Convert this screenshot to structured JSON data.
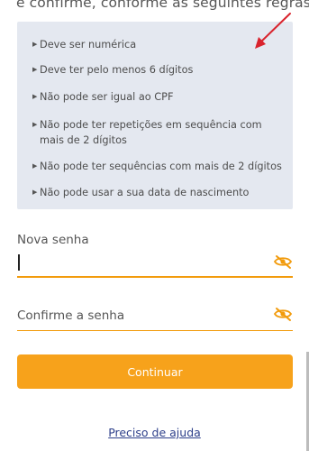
{
  "intro_text": "e confirme, conforme as seguintes regras:",
  "rules": [
    {
      "text": "Deve ser numérica"
    },
    {
      "text": "Deve ter pelo menos 6 dígitos"
    },
    {
      "text": "Não pode ser igual ao CPF"
    },
    {
      "text": "Não pode ter repetições em sequência com mais de 2 dígitos"
    },
    {
      "text": "Não pode ter sequências com mais de 2 dígitos"
    },
    {
      "text": "Não pode usar a sua data de nascimento"
    }
  ],
  "new_password": {
    "label": "Nova senha",
    "value": ""
  },
  "confirm_password": {
    "label": "Confirme a senha",
    "value": ""
  },
  "continue_label": "Continuar",
  "help_link": "Preciso de ajuda",
  "colors": {
    "accent": "#f7a21b",
    "underline": "#f29b0c",
    "rules_bg": "#e4e8f0",
    "link": "#2d3f8a",
    "annotation_arrow": "#d9232d"
  },
  "icons": {
    "bullet": "triangle-right-icon",
    "password_toggle": "eye-slash-icon",
    "annotation": "red-arrow-icon"
  }
}
